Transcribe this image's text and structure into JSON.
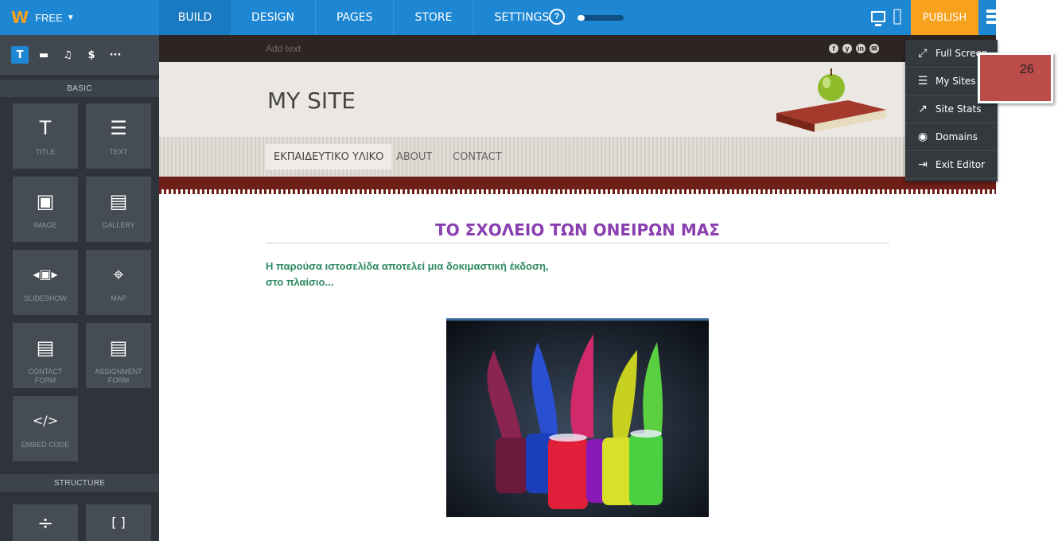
{
  "topbar": {
    "plan_label": "FREE",
    "nav": [
      "BUILD",
      "DESIGN",
      "PAGES",
      "STORE",
      "SETTINGS"
    ],
    "help": "?",
    "progress": 0.15,
    "publish": "PUBLISH"
  },
  "leftpanel": {
    "tabs": [
      "T",
      "▬",
      "♫",
      "$",
      "···"
    ],
    "basic_heading": "BASIC",
    "tiles": [
      {
        "icon": "title-icon",
        "glyph": "T",
        "label": "TITLE"
      },
      {
        "icon": "text-icon",
        "glyph": "☰",
        "label": "TEXT"
      },
      {
        "icon": "image-icon",
        "glyph": "▣",
        "label": "IMAGE"
      },
      {
        "icon": "gallery-icon",
        "glyph": "▤",
        "label": "GALLERY"
      },
      {
        "icon": "slideshow-icon",
        "glyph": "◂▣▸",
        "label": "SLIDESHOW"
      },
      {
        "icon": "map-icon",
        "glyph": "⌖",
        "label": "MAP"
      },
      {
        "icon": "contact-form-icon",
        "glyph": "▤",
        "label": "CONTACT\nFORM"
      },
      {
        "icon": "assignment-form-icon",
        "glyph": "▤",
        "label": "ASSIGNMENT\nFORM"
      },
      {
        "icon": "embed-code-icon",
        "glyph": "</>",
        "label": "EMBED CODE"
      }
    ],
    "structure_heading": "STRUCTURE",
    "structure_tiles": [
      {
        "icon": "divider-icon",
        "glyph": "÷"
      },
      {
        "icon": "spacer-icon",
        "glyph": "[ ]"
      }
    ]
  },
  "editor": {
    "add_text": "Add text",
    "socials": [
      "f",
      "y",
      "in",
      "✉"
    ],
    "site_title": "MY SITE",
    "site_nav": [
      "ΕΚΠΑΙΔΕΥΤΙΚΟ ΥΛΙΚΟ",
      "ABOUT",
      "CONTACT"
    ],
    "page_heading": "ΤΟ ΣΧΟΛΕΙΟ ΤΩΝ ΟΝΕΙΡΩΝ ΜΑΣ",
    "intro_line1": "Η παρούσα ιστοσελίδα αποτελεί μια δοκιμαστική έκδοση,",
    "intro_line2": "στο πλαίσιο..."
  },
  "menu": {
    "items": [
      {
        "icon": "full-screen-icon",
        "glyph": "⤢",
        "label": "Full Screen"
      },
      {
        "icon": "my-sites-icon",
        "glyph": "☰",
        "label": "My Sites"
      },
      {
        "icon": "site-stats-icon",
        "glyph": "↗",
        "label": "Site Stats"
      },
      {
        "icon": "domains-icon",
        "glyph": "◉",
        "label": "Domains"
      },
      {
        "icon": "exit-editor-icon",
        "glyph": "⇥",
        "label": "Exit Editor"
      }
    ]
  },
  "badge": "26",
  "colors": {
    "brand_blue": "#1d87d4",
    "publish_orange": "#f7a11c",
    "heading_purple": "#8a3fb0",
    "intro_green": "#2e8a63",
    "badge_red": "#bb4c4a"
  }
}
